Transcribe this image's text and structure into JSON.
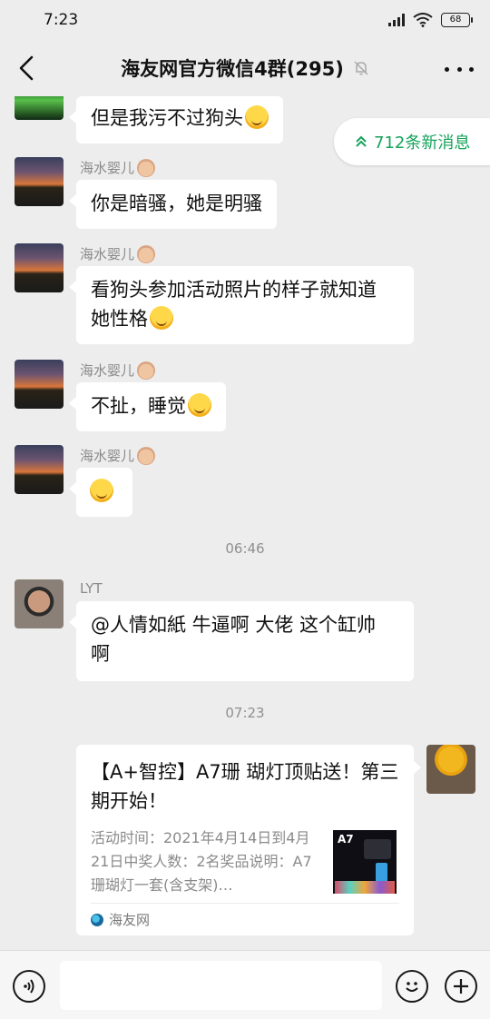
{
  "status_bar": {
    "time": "7:23",
    "battery": "68"
  },
  "header": {
    "title": "海友网官方微信4群(295)",
    "back_icon": "chevron-left-icon",
    "mute_icon": "bell-off-icon",
    "more_icon": "more-dots-icon"
  },
  "new_messages": {
    "label": "712条新消息",
    "icon": "double-chevron-up-icon"
  },
  "messages": [
    {
      "sender": "",
      "text": "但是我污不过狗头",
      "emoji": "laughing-tears-emoji"
    },
    {
      "sender": "海水婴儿",
      "text": "你是暗骚，她是明骚"
    },
    {
      "sender": "海水婴儿",
      "text_line1": "看狗头参加活动照片的样子就知道",
      "text_line2": "她性格",
      "emoji": "thinking-face-emoji"
    },
    {
      "sender": "海水婴儿",
      "text": "不扯，睡觉",
      "emoji": "persevering-face-emoji"
    },
    {
      "sender": "海水婴儿",
      "emoji": "thinking-face-emoji"
    },
    {
      "sender": "LYT",
      "text_line1": "@人情如紙  牛逼啊 大佬 这个缸帅",
      "text_line2": "啊"
    }
  ],
  "timestamps": [
    "06:46",
    "07:23"
  ],
  "link_card": {
    "title": "【A+智控】A7珊 瑚灯顶贴送！第三期开始！",
    "description": "活动时间：2021年4月14日到4月21日中奖人数：2名奖品说明：A7珊瑚灯一套(含支架)…",
    "thumb_label": "A7",
    "source": "海友网"
  },
  "input_bar": {
    "voice_icon": "voice-icon",
    "emoji_icon": "smile-icon",
    "plus_icon": "plus-icon",
    "placeholder": ""
  },
  "colors": {
    "background": "#ededed",
    "accent_green": "#15a35b",
    "bubble": "#ffffff"
  }
}
